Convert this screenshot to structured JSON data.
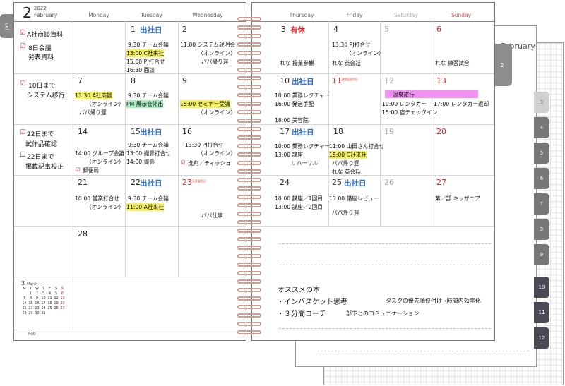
{
  "header": {
    "month_num": "2",
    "year": "2022",
    "month_name": "February",
    "side_tab": "Jan"
  },
  "back_sheet": {
    "title": "February",
    "tab": "2"
  },
  "right_tabs": [
    "3",
    "4",
    "5",
    "6",
    "7",
    "8",
    "9",
    "10",
    "11",
    "12"
  ],
  "days": {
    "mon": "Monday",
    "tue": "Tuesday",
    "wed": "Wednesday",
    "thu": "Thursday",
    "fri": "Friday",
    "sat": "Saturday",
    "sun": "Sunday"
  },
  "todo": {
    "w1": [
      "A社商談資料",
      "8日会議",
      "発表資料"
    ],
    "w2": [
      "10日まで",
      "システム移行"
    ],
    "w3": [
      "22日まで",
      "試作品確認",
      "22日まで",
      "掲載記事校正"
    ]
  },
  "dates": {
    "d1": "1",
    "d2": "2",
    "d3": "3",
    "d4": "4",
    "d5": "5",
    "d6": "6",
    "d7": "7",
    "d8": "8",
    "d9": "9",
    "d10": "10",
    "d11": "11",
    "d12": "12",
    "d13": "13",
    "d14": "14",
    "d15": "15",
    "d16": "16",
    "d17": "17",
    "d18": "18",
    "d19": "19",
    "d20": "20",
    "d21": "21",
    "d22": "22",
    "d23": "23",
    "d24": "24",
    "d25": "25",
    "d26": "26",
    "d27": "27",
    "d28": "28"
  },
  "tags": {
    "office": "出社日",
    "vacation": "有休",
    "holiday_11": "建国記念の日",
    "holiday_23": "天皇誕生日"
  },
  "events": {
    "tue1": [
      "9:30 チーム会議",
      "13:00 C社来社",
      "15:00 PJ打合せ",
      "16:30 面談"
    ],
    "wed1": [
      "11:00 システム説明会",
      "（オンライン）",
      "パパ帰り遅"
    ],
    "thu1": [
      "れな 授業参観"
    ],
    "fri1": [
      "13:30 PJ打合せ",
      "（オンライン）",
      "れな 英会話"
    ],
    "sun1": [
      "れな 練習試合"
    ],
    "mon2": [
      "13:30 A社商談",
      "（オンライン）",
      "パパ帰り遅"
    ],
    "tue2": [
      "9:30 チーム会議",
      "PM 展示会外出"
    ],
    "wed2": [
      "15:00 セミナー受講",
      "（オンライン）"
    ],
    "thu2": [
      "10:00 業務レクチャー",
      "16:00 発送手配",
      "18:00 美容院"
    ],
    "sat_sun2": "温泉旅行",
    "sat2": [
      "10:00 レンタカー",
      "15:00 宿チェックイン"
    ],
    "sun2": [
      "17:00 レンタカー返却"
    ],
    "mon3": [
      "14:00 グループ会議",
      "（オンライン）",
      "郵便局"
    ],
    "tue3": [
      "9:30 チーム会議",
      "13:00 撮影打合せ",
      "14:00 撮影"
    ],
    "wed3": [
      "13:30 PJ打合せ",
      "（オンライン）",
      "洗剤／ティッシュ"
    ],
    "thu3": [
      "10:00 業務レクチャー",
      "13:00 講座",
      "リハーサル"
    ],
    "fri3": [
      "11:00 山田さん打合せ",
      "15:00 C社来社",
      "パパ帰り遅",
      "れな 英会話"
    ],
    "mon4": [
      "10:00 営業打合せ",
      "（オンライン）"
    ],
    "tue4": [
      "9:30 チーム会議",
      "11:00 A社来社"
    ],
    "wed4": [
      "パパ仕事"
    ],
    "thu4": [
      "10:00 講座／1回目",
      "13:00 講座／2回目"
    ],
    "fri4": [
      "13:00 講座レビュー",
      "パパ帰り遅"
    ],
    "sun4": [
      "第／部 キッザニア"
    ]
  },
  "mini_cal": {
    "month_num": "3",
    "month_name": "March",
    "headers": [
      "M",
      "T",
      "W",
      "T",
      "F",
      "S",
      "S"
    ],
    "rows": [
      [
        "",
        "1",
        "2",
        "3",
        "4",
        "5",
        "6"
      ],
      [
        "7",
        "8",
        "9",
        "10",
        "11",
        "12",
        "13"
      ],
      [
        "14",
        "15",
        "16",
        "17",
        "18",
        "19",
        "20"
      ],
      [
        "21",
        "22",
        "23",
        "24",
        "25",
        "26",
        "27"
      ],
      [
        "28",
        "29",
        "30",
        "31",
        "",
        "",
        ""
      ]
    ]
  },
  "footer_month": "Feb",
  "notes": {
    "title": "オススメの本",
    "item1": "・インバスケット思考",
    "item1_sub": "タスクの優先順位付け→時間内効率化",
    "item2": "・３分間コーチ",
    "item2_sub": "部下とのコミュニケーション"
  }
}
